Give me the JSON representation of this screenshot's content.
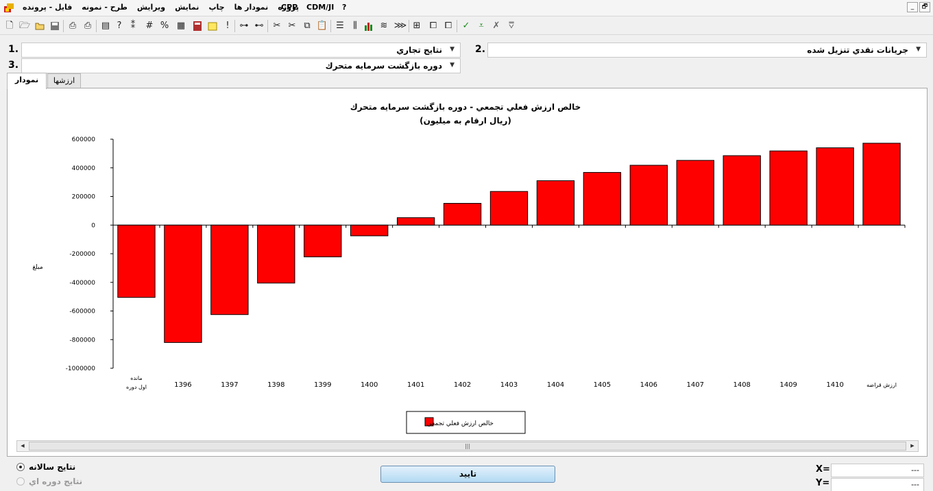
{
  "menu": {
    "items": [
      "فايل - پرونده",
      "طرح - نمونه",
      "ويرايش",
      "نمايش",
      "چاپ",
      "نمودار ها",
      "پروژه"
    ],
    "cpp": "CPP",
    "cdm": "CDM/JI",
    "help": "?"
  },
  "window_buttons": [
    "_",
    "🗗"
  ],
  "selectors": {
    "s1": {
      "num": "1.",
      "value": "نتايج تجاري"
    },
    "s2": {
      "num": "2.",
      "value": "جريانات نقدي تنزيل شده"
    },
    "s3": {
      "num": "3.",
      "value": "دوره بازگشت سرمايه متحرك"
    }
  },
  "tabs": {
    "chart": "نمودار",
    "values": "ارزشها"
  },
  "chart_data": {
    "type": "bar",
    "title": "خالص ارزش فعلي تجمعي - دوره بازگشت سرمايه متحرك",
    "subtitle": "(ريال  ارقام به ميليون)",
    "ylabel": "مبلغ",
    "xlabel": "",
    "ylim": [
      -1000000,
      600000
    ],
    "yticks": [
      600000,
      400000,
      200000,
      0,
      -200000,
      -400000,
      -600000,
      -800000,
      -1000000
    ],
    "ytick_labels": [
      "600000",
      "400000",
      "200000",
      "0",
      "-200000",
      "-400000",
      "-600000",
      "-800000",
      "-1000000"
    ],
    "categories": [
      "مانده\nاول دوره",
      "1396",
      "1397",
      "1398",
      "1399",
      "1400",
      "1401",
      "1402",
      "1403",
      "1404",
      "1405",
      "1406",
      "1407",
      "1408",
      "1409",
      "1410",
      "ارزش قراضه"
    ],
    "series": [
      {
        "name": "خالص ارزش فعلي تجمعي",
        "color": "#ff0000",
        "values": [
          -505000,
          -820000,
          -625000,
          -405000,
          -222000,
          -75000,
          52000,
          152000,
          235000,
          310000,
          368000,
          418000,
          452000,
          485000,
          518000,
          540000,
          572000
        ]
      }
    ],
    "legend_position": "bottom-center",
    "grid": false
  },
  "bottom": {
    "radio_annual": "نتايج سالانه",
    "radio_period": "نتايج دوره اي",
    "ok": "تاييد",
    "x_label": "X=",
    "y_label": "Y=",
    "x_value": "---",
    "y_value": "---"
  }
}
